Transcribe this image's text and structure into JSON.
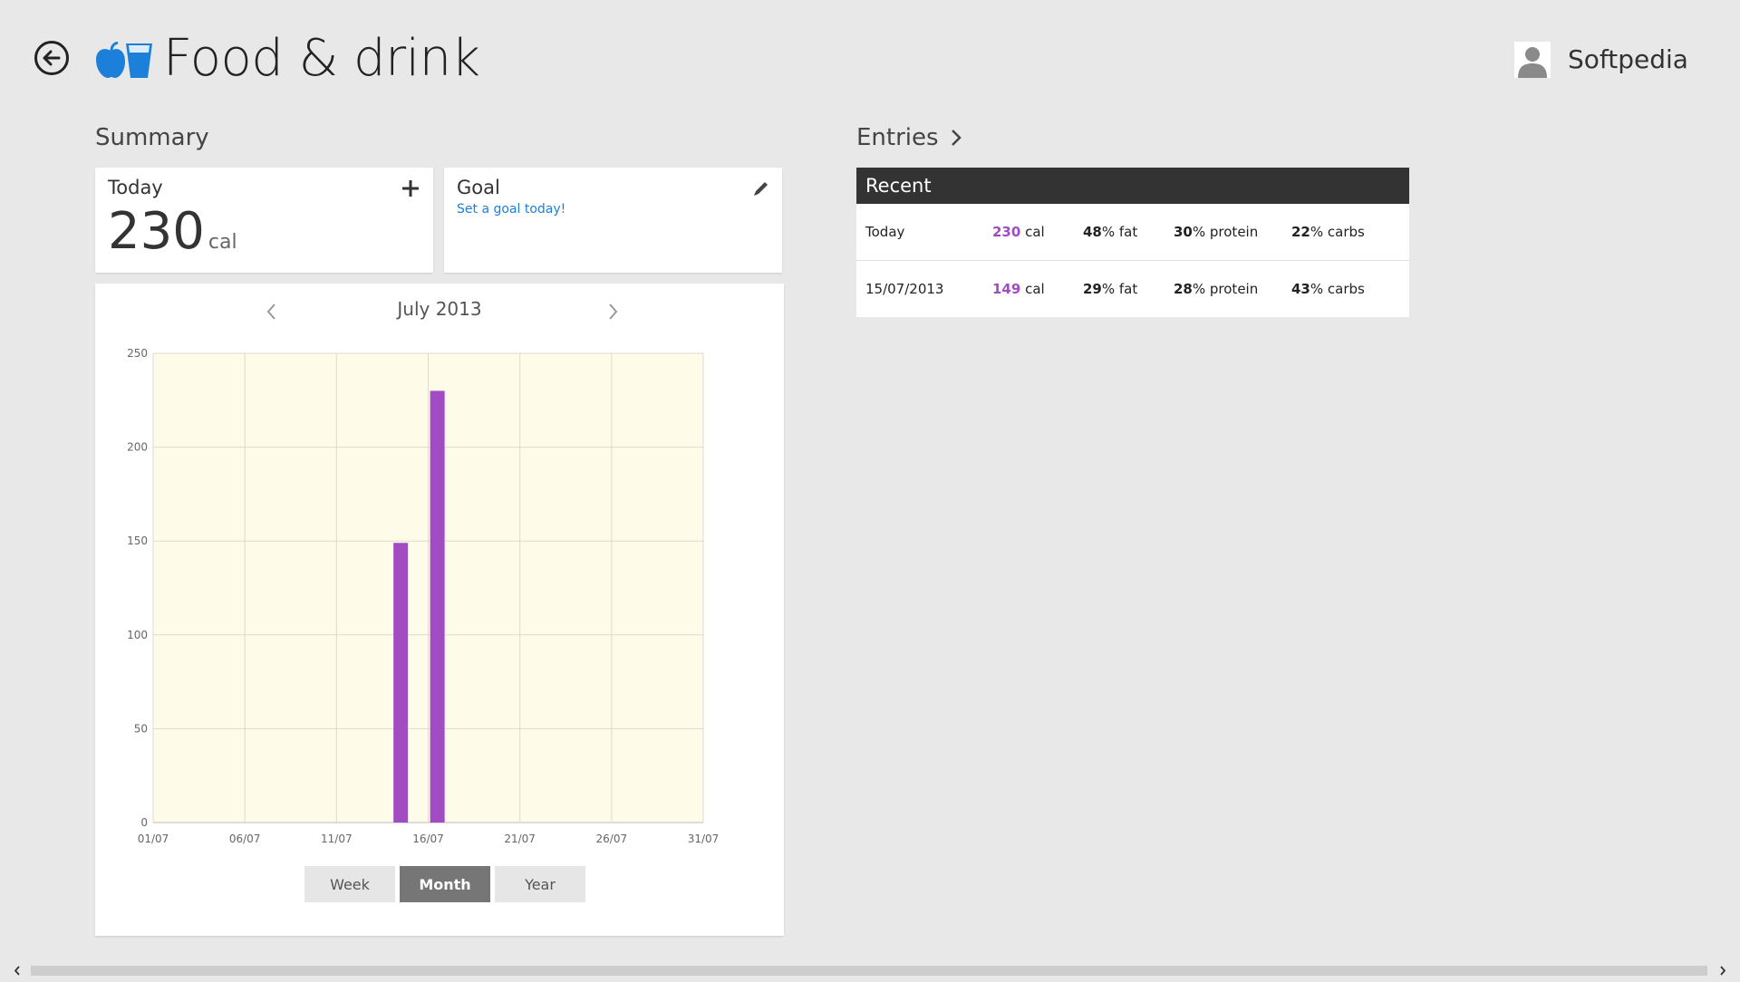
{
  "header": {
    "title": "Food & drink",
    "user_name": "Softpedia"
  },
  "summary": {
    "heading": "Summary",
    "today": {
      "label": "Today",
      "value": "230",
      "unit": "cal"
    },
    "goal": {
      "label": "Goal",
      "link": "Set a goal today!"
    }
  },
  "chart": {
    "month_label": "July 2013",
    "range_buttons": [
      {
        "label": "Week",
        "active": false
      },
      {
        "label": "Month",
        "active": true
      },
      {
        "label": "Year",
        "active": false
      }
    ],
    "colors": {
      "bar": "#a24cc4",
      "plot_bg": "#fffbe9",
      "grid": "#dedbcc"
    }
  },
  "chart_data": {
    "type": "bar",
    "x": [
      "14/07",
      "16/07"
    ],
    "x_day": [
      14.5,
      16.5
    ],
    "values": [
      149,
      230
    ],
    "x_ticks": [
      "01/07",
      "06/07",
      "11/07",
      "16/07",
      "21/07",
      "26/07",
      "31/07"
    ],
    "x_tick_days": [
      1,
      6,
      11,
      16,
      21,
      26,
      31
    ],
    "y_ticks": [
      0,
      50,
      100,
      150,
      200,
      250
    ],
    "ylim": [
      0,
      250
    ],
    "xlim": [
      1,
      31
    ],
    "grid": true
  },
  "entries": {
    "heading": "Entries",
    "recent_label": "Recent",
    "rows": [
      {
        "date": "Today",
        "cal": "230",
        "cal_unit": " cal",
        "fat": "48",
        "fat_unit": "% fat",
        "protein": "30",
        "protein_unit": "% protein",
        "carbs": "22",
        "carbs_unit": "% carbs"
      },
      {
        "date": "15/07/2013",
        "cal": "149",
        "cal_unit": " cal",
        "fat": "29",
        "fat_unit": "% fat",
        "protein": "28",
        "protein_unit": "% protein",
        "carbs": "43",
        "carbs_unit": "% carbs"
      }
    ]
  }
}
